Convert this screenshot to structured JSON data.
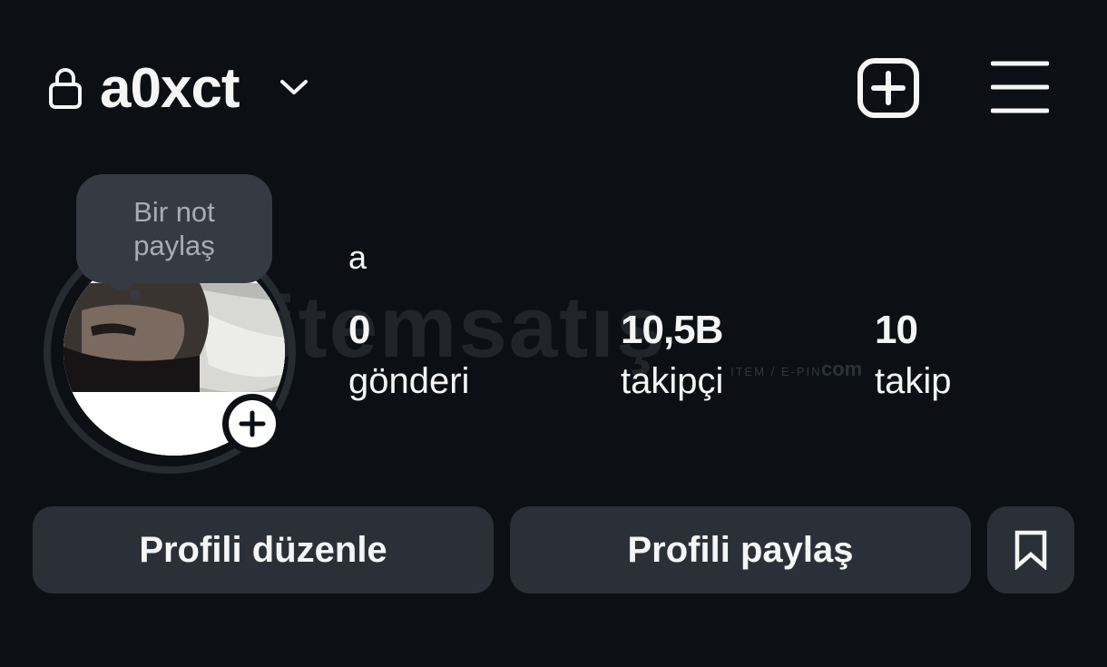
{
  "header": {
    "username": "a0xct",
    "icons": [
      "lock-icon",
      "chevron-down-icon",
      "new-post-icon",
      "menu-icon"
    ]
  },
  "note": {
    "text": "Bir not paylaş"
  },
  "profile": {
    "display_name": "a",
    "stats": {
      "posts": {
        "value": "0",
        "label": "gönderi"
      },
      "followers": {
        "value": "10,5B",
        "label": "takipçi"
      },
      "following": {
        "value": "10",
        "label": "takip"
      }
    }
  },
  "buttons": {
    "edit_profile": "Profili düzenle",
    "share_profile": "Profili paylaş",
    "save_icon": "bookmark-icon"
  },
  "watermark": {
    "main": "itemsatış",
    "sub": "ITEM / E-PIN",
    "suffix": "com"
  },
  "colors": {
    "background": "#0c1014",
    "button": "#2b3038",
    "note_bubble": "#363a42",
    "text": "#f5f5f5",
    "muted_text": "#a8adb5"
  }
}
